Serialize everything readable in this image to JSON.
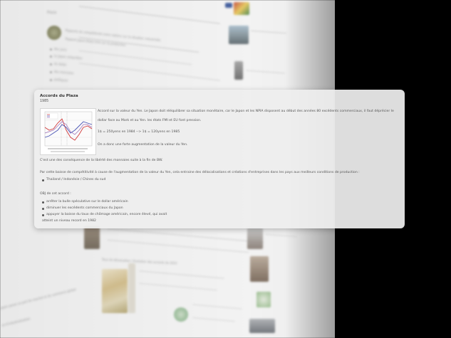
{
  "card": {
    "title": "Accords du Plaza",
    "year": "1985",
    "paragraph1_line1": "Accord sur la valeur du Yen. Le Japon doit rééquilibrer sa situation monétaire, car le Japon et les NPIA disposent au début des années 80 excédents commerciaux, il faut déprécier le",
    "paragraph1_line2": "dollar face au Mark et au Yen. les états FMI et EU font pression.",
    "rate_line": "1$ = 250yens en 1984 --> 1$ = 120yens en 1985",
    "consequence": "On a donc une forte augmentation de la valeur du Yen.",
    "line_bi": "C'est une des conséquence de la libérté des monnaies suite à la fin de BW.",
    "line_competitivity": "Par cette baisse de compétitivité à cause de l'augmentation de la valeur du Yen, cela entraine des délocalisations et créations d'entreprises dans les pays aux meilleurs conditions de production :",
    "countries": "Thailand / Indonésie / Chines du sud",
    "objectives_title": "OBJ de cet accord :",
    "objectives": [
      "arrêter la bulle spéculative sur le dollar américain",
      "diminuer les excédents commerciaux du Japon",
      "appuyer la baisse du taux de chômage américain, encore élevé, qui avait",
      "atteint un niveau record en 1982"
    ]
  },
  "background": {
    "top_label": "Plaza",
    "item_lines": [
      "Rapports de compétitivité entre nations sur la situation industrielle",
      "Rapport Japon-Etats-Unis sur la production",
      "des yens",
      "Le Japon rééquilibre",
      "du dollar",
      "des monnaies",
      "politiques"
    ],
    "bottom_caption": "Taux de dévaluation / Evolution des accords de 2010",
    "left_bottom_lines": [
      "Le japon passe sa part de marché et de commerce global",
      "et d'industrialisation"
    ]
  },
  "colors": {
    "card_bg": "#eeeeee",
    "chart_line_red": "#d23c3c",
    "chart_line_blue": "#4a55b5",
    "chart_line_purple": "#9a6bb5"
  }
}
